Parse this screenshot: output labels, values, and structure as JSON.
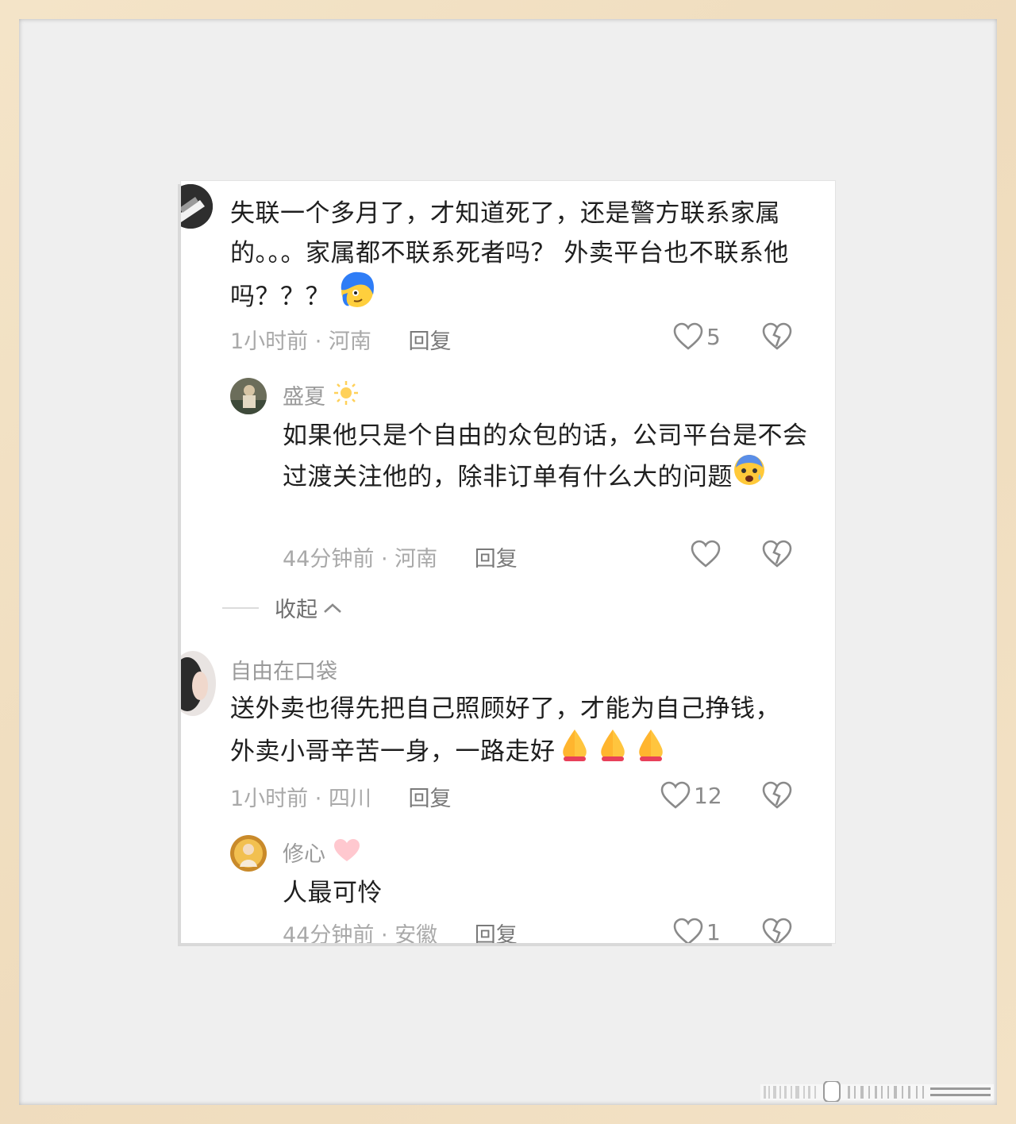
{
  "comments": [
    {
      "text": "失联一个多月了，才知道死了，还是警方联系家属的。。。家属都不联系死者吗？ 外卖平台也不联系他吗？？？",
      "emoji": "blue-hair-face-emoji",
      "time_location": "1小时前 · 河南",
      "reply_label": "回复",
      "likes": "5",
      "replies": [
        {
          "name": "盛夏",
          "name_emoji": "sun-emoji",
          "text": "如果他只是个自由的众包的话，公司平台是不会过渡关注他的，除非订单有什么大的问题",
          "emoji": "anxious-face-emoji",
          "time_location": "44分钟前 · 河南",
          "reply_label": "回复",
          "likes": ""
        }
      ],
      "collapse_label": "收起"
    },
    {
      "name": "自由在口袋",
      "text": "送外卖也得先把自己照顾好了，才能为自己挣钱，外卖小哥辛苦一身，一路走好",
      "emoji": "folded-hands-emoji",
      "time_location": "1小时前 · 四川",
      "reply_label": "回复",
      "likes": "12",
      "replies": [
        {
          "name": "修心",
          "name_emoji": "pink-heart-emoji",
          "text": "人最可怜",
          "time_location": "44分钟前 · 安徽",
          "reply_label": "回复",
          "likes": "1"
        }
      ]
    }
  ],
  "colors": {
    "frame": "#f1e0c4",
    "mat": "#efefef",
    "card": "#ffffff",
    "text": "#1f1f1f",
    "meta": "#a9a9a9",
    "blue_emoji": "#2f7df6"
  }
}
